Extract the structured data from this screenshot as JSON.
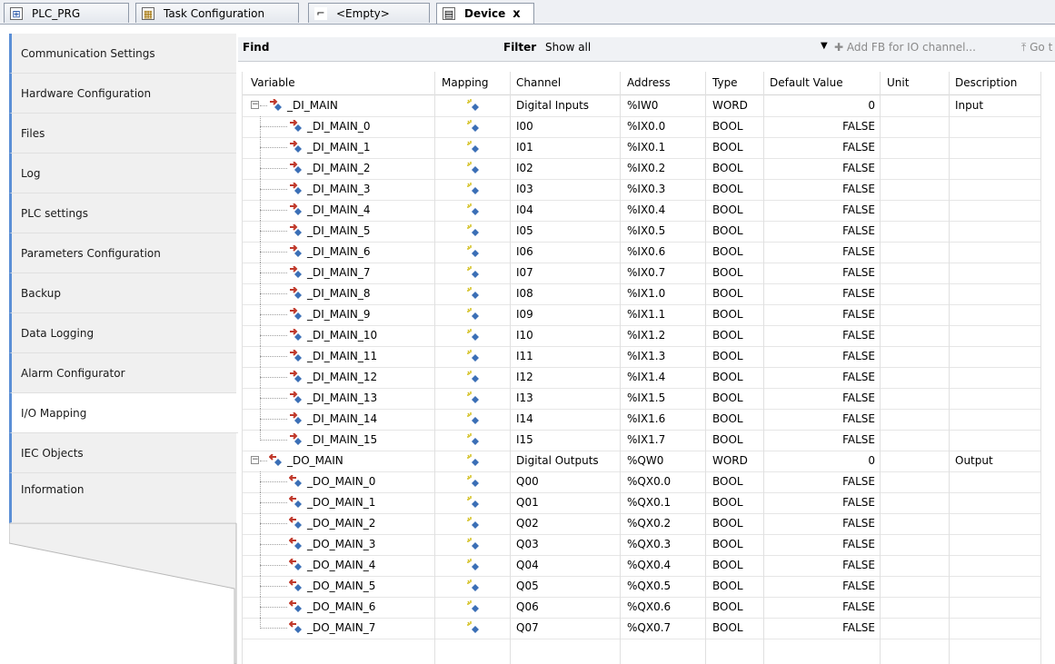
{
  "tabs": [
    {
      "label": "PLC_PRG",
      "icon": "program-icon"
    },
    {
      "label": "Task Configuration",
      "icon": "task-config-icon"
    },
    {
      "label": "<Empty>",
      "icon": "empty-icon"
    },
    {
      "label": "Device",
      "icon": "device-icon",
      "close": "x"
    }
  ],
  "sidebar": {
    "items": [
      {
        "label": "Communication Settings"
      },
      {
        "label": "Hardware Configuration"
      },
      {
        "label": "Files"
      },
      {
        "label": "Log"
      },
      {
        "label": "PLC settings"
      },
      {
        "label": "Parameters Configuration"
      },
      {
        "label": "Backup"
      },
      {
        "label": "Data Logging"
      },
      {
        "label": "Alarm Configurator"
      },
      {
        "label": "I/O Mapping"
      },
      {
        "label": "IEC Objects"
      },
      {
        "label": "Information"
      }
    ],
    "active_index": 9
  },
  "toolbar": {
    "find_label": "Find",
    "filter_label": "Filter",
    "filter_value": "Show all",
    "add_fb_label": "Add FB for IO channel...",
    "goto_label": "Go t"
  },
  "table": {
    "columns": [
      "Variable",
      "Mapping",
      "Channel",
      "Address",
      "Type",
      "Default Value",
      "Unit",
      "Description"
    ],
    "rows": [
      {
        "level": 0,
        "variable": "_DI_MAIN",
        "channel": "Digital Inputs",
        "address": "%IW0",
        "type": "WORD",
        "default": "0",
        "unit": "",
        "description": "Input",
        "kind": "in",
        "expander": "−"
      },
      {
        "level": 1,
        "variable": "_DI_MAIN_0",
        "channel": "I00",
        "address": "%IX0.0",
        "type": "BOOL",
        "default": "FALSE",
        "unit": "",
        "description": "",
        "kind": "in"
      },
      {
        "level": 1,
        "variable": "_DI_MAIN_1",
        "channel": "I01",
        "address": "%IX0.1",
        "type": "BOOL",
        "default": "FALSE",
        "unit": "",
        "description": "",
        "kind": "in"
      },
      {
        "level": 1,
        "variable": "_DI_MAIN_2",
        "channel": "I02",
        "address": "%IX0.2",
        "type": "BOOL",
        "default": "FALSE",
        "unit": "",
        "description": "",
        "kind": "in"
      },
      {
        "level": 1,
        "variable": "_DI_MAIN_3",
        "channel": "I03",
        "address": "%IX0.3",
        "type": "BOOL",
        "default": "FALSE",
        "unit": "",
        "description": "",
        "kind": "in"
      },
      {
        "level": 1,
        "variable": "_DI_MAIN_4",
        "channel": "I04",
        "address": "%IX0.4",
        "type": "BOOL",
        "default": "FALSE",
        "unit": "",
        "description": "",
        "kind": "in"
      },
      {
        "level": 1,
        "variable": "_DI_MAIN_5",
        "channel": "I05",
        "address": "%IX0.5",
        "type": "BOOL",
        "default": "FALSE",
        "unit": "",
        "description": "",
        "kind": "in"
      },
      {
        "level": 1,
        "variable": "_DI_MAIN_6",
        "channel": "I06",
        "address": "%IX0.6",
        "type": "BOOL",
        "default": "FALSE",
        "unit": "",
        "description": "",
        "kind": "in"
      },
      {
        "level": 1,
        "variable": "_DI_MAIN_7",
        "channel": "I07",
        "address": "%IX0.7",
        "type": "BOOL",
        "default": "FALSE",
        "unit": "",
        "description": "",
        "kind": "in"
      },
      {
        "level": 1,
        "variable": "_DI_MAIN_8",
        "channel": "I08",
        "address": "%IX1.0",
        "type": "BOOL",
        "default": "FALSE",
        "unit": "",
        "description": "",
        "kind": "in"
      },
      {
        "level": 1,
        "variable": "_DI_MAIN_9",
        "channel": "I09",
        "address": "%IX1.1",
        "type": "BOOL",
        "default": "FALSE",
        "unit": "",
        "description": "",
        "kind": "in"
      },
      {
        "level": 1,
        "variable": "_DI_MAIN_10",
        "channel": "I10",
        "address": "%IX1.2",
        "type": "BOOL",
        "default": "FALSE",
        "unit": "",
        "description": "",
        "kind": "in"
      },
      {
        "level": 1,
        "variable": "_DI_MAIN_11",
        "channel": "I11",
        "address": "%IX1.3",
        "type": "BOOL",
        "default": "FALSE",
        "unit": "",
        "description": "",
        "kind": "in"
      },
      {
        "level": 1,
        "variable": "_DI_MAIN_12",
        "channel": "I12",
        "address": "%IX1.4",
        "type": "BOOL",
        "default": "FALSE",
        "unit": "",
        "description": "",
        "kind": "in"
      },
      {
        "level": 1,
        "variable": "_DI_MAIN_13",
        "channel": "I13",
        "address": "%IX1.5",
        "type": "BOOL",
        "default": "FALSE",
        "unit": "",
        "description": "",
        "kind": "in"
      },
      {
        "level": 1,
        "variable": "_DI_MAIN_14",
        "channel": "I14",
        "address": "%IX1.6",
        "type": "BOOL",
        "default": "FALSE",
        "unit": "",
        "description": "",
        "kind": "in"
      },
      {
        "level": 1,
        "variable": "_DI_MAIN_15",
        "channel": "I15",
        "address": "%IX1.7",
        "type": "BOOL",
        "default": "FALSE",
        "unit": "",
        "description": "",
        "kind": "in"
      },
      {
        "level": 0,
        "variable": "_DO_MAIN",
        "channel": "Digital Outputs",
        "address": "%QW0",
        "type": "WORD",
        "default": "0",
        "unit": "",
        "description": "Output",
        "kind": "out",
        "expander": "−"
      },
      {
        "level": 1,
        "variable": "_DO_MAIN_0",
        "channel": "Q00",
        "address": "%QX0.0",
        "type": "BOOL",
        "default": "FALSE",
        "unit": "",
        "description": "",
        "kind": "out"
      },
      {
        "level": 1,
        "variable": "_DO_MAIN_1",
        "channel": "Q01",
        "address": "%QX0.1",
        "type": "BOOL",
        "default": "FALSE",
        "unit": "",
        "description": "",
        "kind": "out"
      },
      {
        "level": 1,
        "variable": "_DO_MAIN_2",
        "channel": "Q02",
        "address": "%QX0.2",
        "type": "BOOL",
        "default": "FALSE",
        "unit": "",
        "description": "",
        "kind": "out"
      },
      {
        "level": 1,
        "variable": "_DO_MAIN_3",
        "channel": "Q03",
        "address": "%QX0.3",
        "type": "BOOL",
        "default": "FALSE",
        "unit": "",
        "description": "",
        "kind": "out"
      },
      {
        "level": 1,
        "variable": "_DO_MAIN_4",
        "channel": "Q04",
        "address": "%QX0.4",
        "type": "BOOL",
        "default": "FALSE",
        "unit": "",
        "description": "",
        "kind": "out"
      },
      {
        "level": 1,
        "variable": "_DO_MAIN_5",
        "channel": "Q05",
        "address": "%QX0.5",
        "type": "BOOL",
        "default": "FALSE",
        "unit": "",
        "description": "",
        "kind": "out"
      },
      {
        "level": 1,
        "variable": "_DO_MAIN_6",
        "channel": "Q06",
        "address": "%QX0.6",
        "type": "BOOL",
        "default": "FALSE",
        "unit": "",
        "description": "",
        "kind": "out"
      },
      {
        "level": 1,
        "variable": "_DO_MAIN_7",
        "channel": "Q07",
        "address": "%QX0.7",
        "type": "BOOL",
        "default": "FALSE",
        "unit": "",
        "description": "",
        "kind": "out"
      }
    ]
  },
  "colors": {
    "accent": "#5b8fd6",
    "input_arrow": "#c0392b",
    "output_arrow": "#c0392b",
    "variable_icon": "#3b6fb6",
    "mapping_icon": "#d4c020"
  }
}
